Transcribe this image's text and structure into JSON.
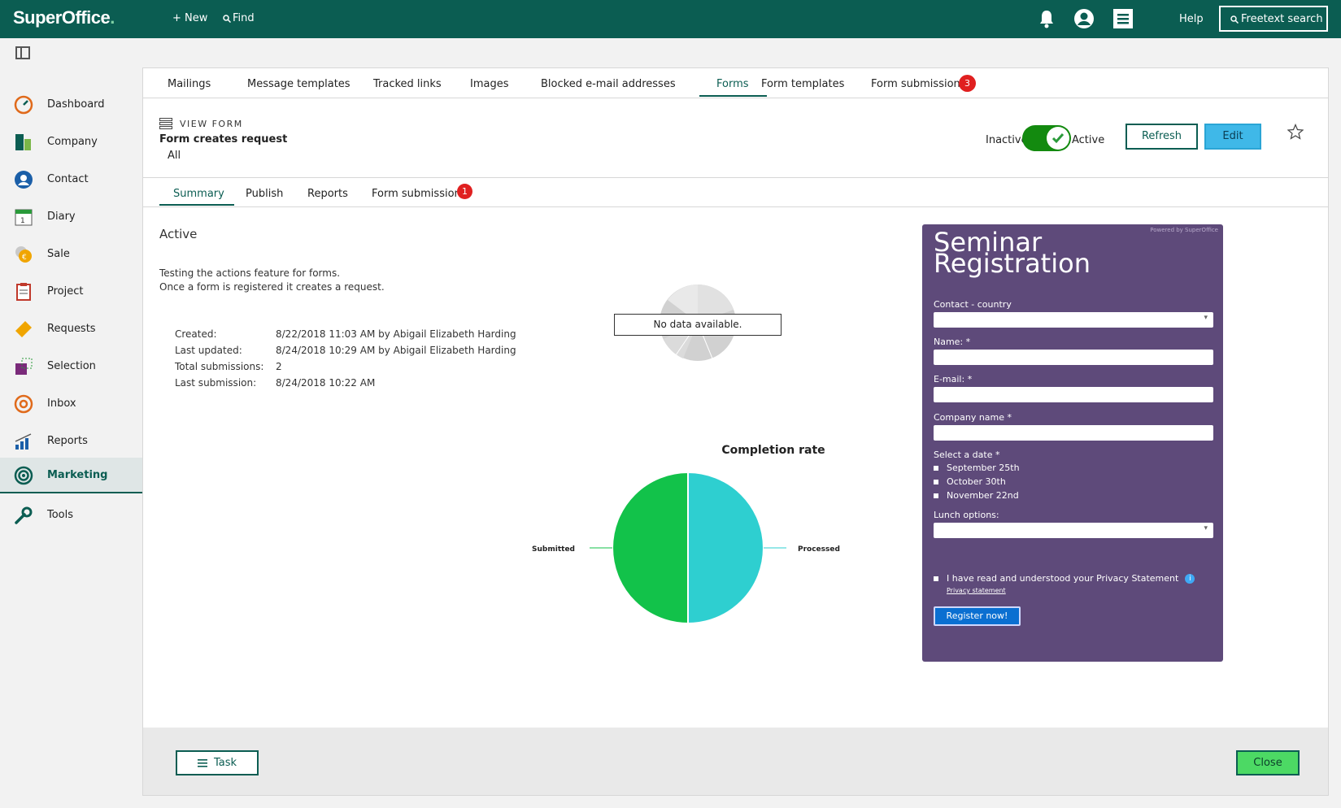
{
  "header": {
    "logo": "SuperOffice",
    "new_label": "+ New",
    "find_label": "Find",
    "help_label": "Help",
    "freetext_label": "Freetext search"
  },
  "sidebar": {
    "items": [
      {
        "label": "Dashboard",
        "icon": "dashboard-icon"
      },
      {
        "label": "Company",
        "icon": "company-icon"
      },
      {
        "label": "Contact",
        "icon": "contact-icon"
      },
      {
        "label": "Diary",
        "icon": "diary-icon"
      },
      {
        "label": "Sale",
        "icon": "sale-icon"
      },
      {
        "label": "Project",
        "icon": "project-icon"
      },
      {
        "label": "Requests",
        "icon": "requests-icon"
      },
      {
        "label": "Selection",
        "icon": "selection-icon"
      },
      {
        "label": "Inbox",
        "icon": "inbox-icon"
      },
      {
        "label": "Reports",
        "icon": "reports-icon"
      },
      {
        "label": "Marketing",
        "icon": "marketing-icon"
      },
      {
        "label": "Tools",
        "icon": "tools-icon"
      }
    ],
    "active": "Marketing"
  },
  "tabs": {
    "items": [
      "Mailings",
      "Message templates",
      "Tracked links",
      "Images",
      "Blocked e-mail addresses",
      "Forms",
      "Form templates",
      "Form submissions"
    ],
    "active": "Forms",
    "submissions_badge": "3"
  },
  "view": {
    "label": "VIEW FORM",
    "title": "Form creates request",
    "subtitle": "All",
    "inactive_label": "Inactive",
    "active_label": "Active",
    "toggle_on": true,
    "refresh_label": "Refresh",
    "edit_label": "Edit"
  },
  "subtabs": {
    "items": [
      "Summary",
      "Publish",
      "Reports",
      "Form submissions"
    ],
    "active": "Summary",
    "submissions_badge": "1"
  },
  "summary": {
    "status": "Active",
    "description_line1": "Testing the actions feature for forms.",
    "description_line2": "Once a form is registered it creates a request.",
    "info": [
      {
        "key": "Created:",
        "value": "8/22/2018 11:03 AM by Abigail Elizabeth Harding"
      },
      {
        "key": "Last updated:",
        "value": "8/24/2018 10:29 AM by Abigail Elizabeth Harding"
      },
      {
        "key": "Total submissions:",
        "value": "2"
      },
      {
        "key": "Last submission:",
        "value": "8/24/2018 10:22 AM"
      }
    ],
    "no_data": "No data available."
  },
  "chart_data": {
    "type": "pie",
    "title": "Completion rate",
    "categories": [
      "Submitted",
      "Processed"
    ],
    "values": [
      1,
      1
    ],
    "colors": [
      "#12c24a",
      "#2ecfd0"
    ]
  },
  "form_preview": {
    "powered_by": "Powered by SuperOffice",
    "title_line1": "Seminar",
    "title_line2": "Registration",
    "fields": {
      "country": "Contact - country",
      "name": "Name: *",
      "email": "E-mail: *",
      "company": "Company name *",
      "date": "Select a date *",
      "lunch": "Lunch options:"
    },
    "date_options": [
      "September 25th",
      "October 30th",
      "November 22nd"
    ],
    "privacy_text": "I have read and understood your Privacy Statement",
    "privacy_link": "Privacy statement",
    "register_label": "Register now!",
    "background": "#5e4a7a"
  },
  "footer": {
    "task_label": "Task",
    "close_label": "Close"
  },
  "colors": {
    "brand": "#0b5d52",
    "edit_button": "#3fb8e8",
    "close_button": "#4cd964",
    "badge": "#e02020"
  }
}
